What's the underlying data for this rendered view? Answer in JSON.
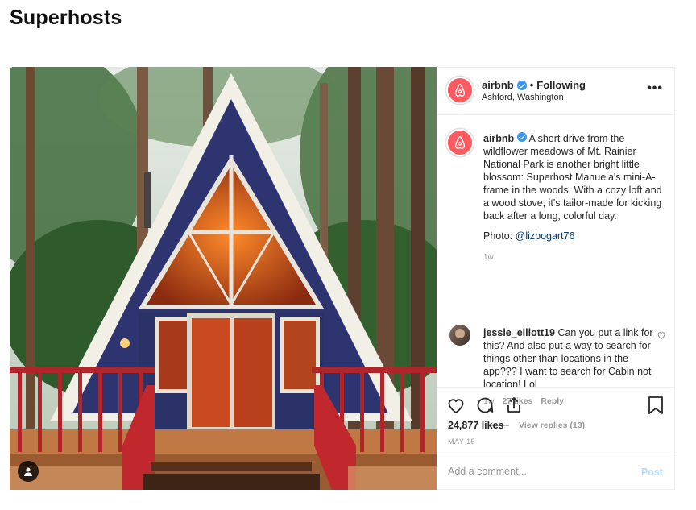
{
  "page": {
    "heading": "Superhosts"
  },
  "post": {
    "account": "airbnb",
    "follow_separator": "•",
    "follow_label": "Following",
    "location": "Ashford, Washington",
    "more_label": "•••",
    "caption_user": "airbnb",
    "caption_text": "A short drive from the wildflower meadows of Mt. Rainier National Park is another bright little blossom: Superhost Manuela's mini-A-frame in the woods. With a cozy loft and a wood stove, it's tailor-made for kicking back after a long, colorful day.",
    "photo_credit_label": "Photo:",
    "photo_credit_handle": "@lizbogart76",
    "caption_time": "1w",
    "comment": {
      "user": "jessie_elliott19",
      "text": "Can you put a link for this? And also put a way to search for things other than locations in the app??? I want to search for Cabin not location! Lol",
      "time": "1w",
      "likes": "27 likes",
      "reply_label": "Reply",
      "view_replies": "View replies (13)"
    },
    "likes": "24,877 likes",
    "date": "MAY 15",
    "add_comment_placeholder": "Add a comment...",
    "post_button": "Post"
  },
  "colors": {
    "brand": "#ff5a5f",
    "verified": "#3897f0",
    "link": "#003569",
    "post_disabled": "#b3dbff"
  },
  "icons": [
    "airbnb-logo-icon",
    "verified-icon",
    "more-icon",
    "heart-icon",
    "comment-icon",
    "share-icon",
    "bookmark-icon",
    "user-tag-icon"
  ]
}
